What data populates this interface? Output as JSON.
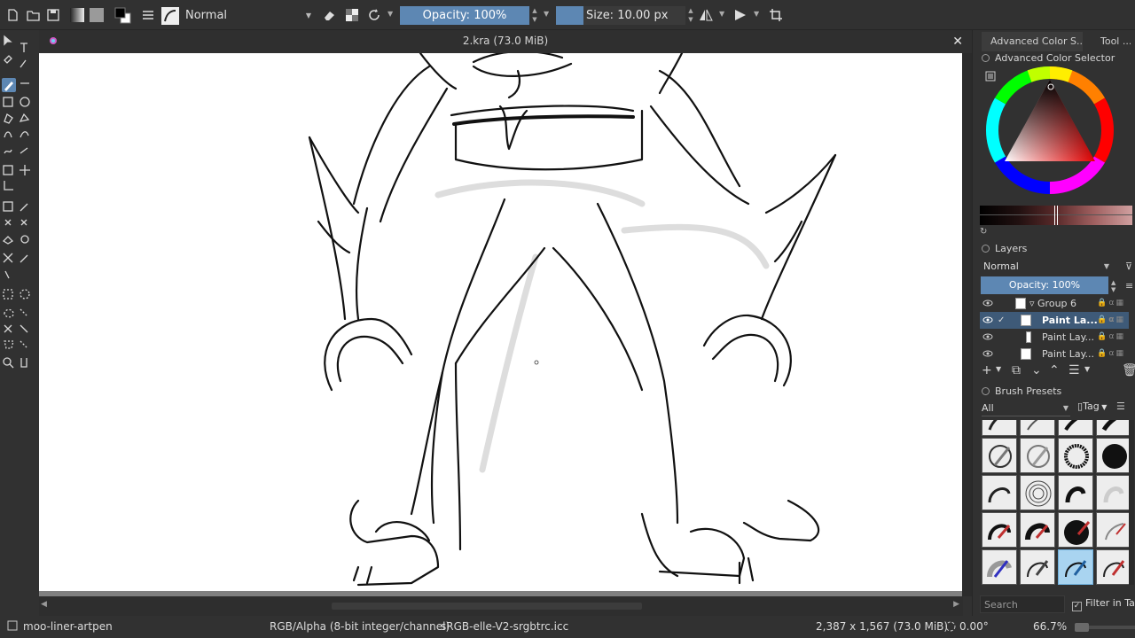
{
  "toolbar": {
    "blend_mode": "Normal",
    "opacity": "Opacity: 100%",
    "size": "Size: 10.00 px"
  },
  "document": {
    "title": "2.kra (73.0 MiB)",
    "close": "✕"
  },
  "status": {
    "brush_preset": "moo-liner-artpen",
    "color_model": "RGB/Alpha (8-bit integer/channel)",
    "profile": "sRGB-elle-V2-srgbtrc.icc",
    "dimensions": "2,387 x 1,567 (73.0 MiB)",
    "rotation": "0.00°",
    "zoom": "66.7%"
  },
  "docker": {
    "tabs": [
      "Advanced Color S...",
      "Tool ..."
    ],
    "color_selector_title": "Advanced Color Selector",
    "layers_title": "Layers",
    "layer_blend_mode": "Normal",
    "layer_opacity": "Opacity:  100%",
    "layers": [
      {
        "name": "Group 6",
        "selected": false
      },
      {
        "name": "Paint La...",
        "selected": true
      },
      {
        "name": "Paint Lay...",
        "selected": false
      },
      {
        "name": "Paint Lay...",
        "selected": false
      }
    ],
    "brush_presets_title": "Brush Presets",
    "preset_filter": "All",
    "tag_button": "Tag",
    "search_placeholder": "Search",
    "filter_in_tag": "Filter in Tag"
  },
  "colors": {
    "accent": "#5d87b3",
    "panel_bg": "#313131",
    "canvas_bg": "#ffffff"
  }
}
